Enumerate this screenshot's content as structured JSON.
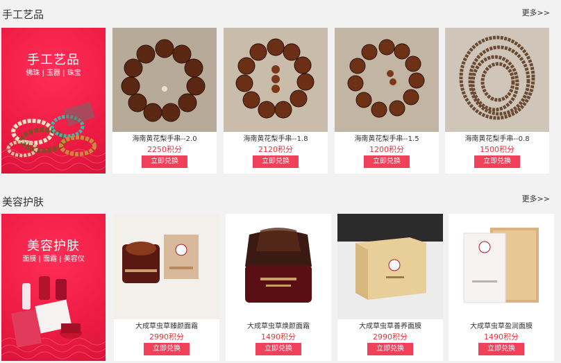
{
  "sections": [
    {
      "title": "手工艺品",
      "more": "更多>>",
      "banner": {
        "title": "手工艺品",
        "subtitle": "佛珠 | 玉器 | 珠宝"
      },
      "products": [
        {
          "name": "海南黄花梨手串--2.0",
          "price": "2250积分",
          "button": "立即兑换"
        },
        {
          "name": "海南黄花梨手串--1.8",
          "price": "2120积分",
          "button": "立即兑换"
        },
        {
          "name": "海南黄花梨手串--1.5",
          "price": "1200积分",
          "button": "立即兑换"
        },
        {
          "name": "海南黄花梨手串--0.8",
          "price": "1500积分",
          "button": "立即兑换"
        }
      ]
    },
    {
      "title": "美容护肤",
      "more": "更多>>",
      "banner": {
        "title": "美容护肤",
        "subtitle": "面膜 | 面霜 | 美容仪"
      },
      "products": [
        {
          "name": "大成草虫草臻颜面霜",
          "price": "2990积分",
          "button": "立即兑换"
        },
        {
          "name": "大成草虫草焕颜面霜",
          "price": "1490积分",
          "button": "立即兑换"
        },
        {
          "name": "大成草虫草善养面膜",
          "price": "2990积分",
          "button": "立即兑换"
        },
        {
          "name": "大成草虫草盈润面膜",
          "price": "1490积分",
          "button": "立即兑换"
        }
      ]
    }
  ],
  "colors": {
    "accent": "#ee1c44",
    "price": "#e8333a",
    "button": "#f0405a"
  }
}
